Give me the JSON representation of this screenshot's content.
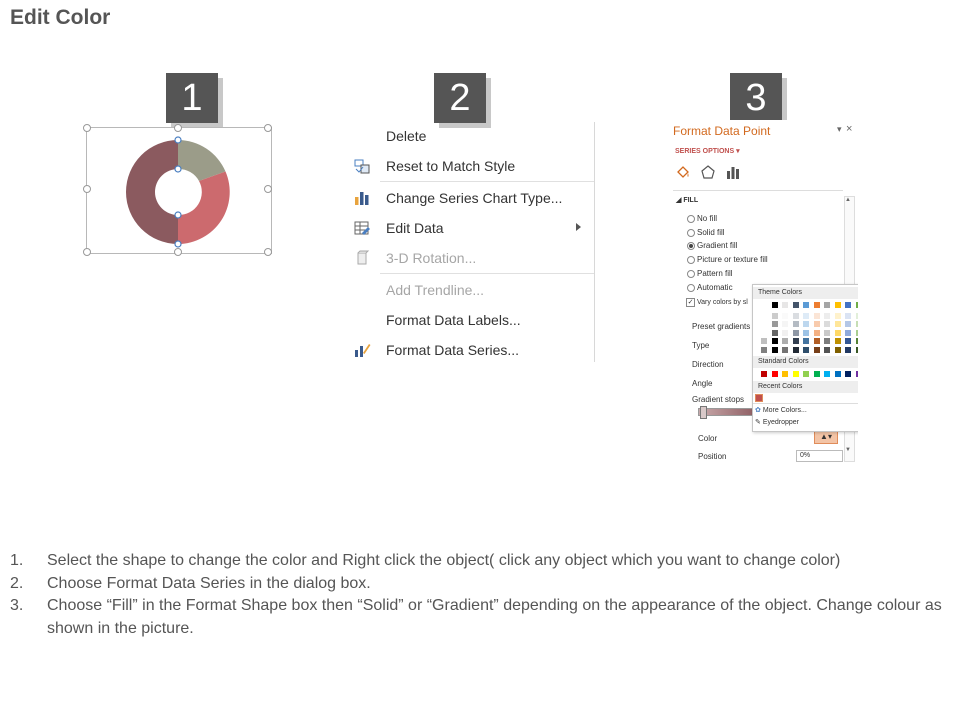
{
  "title": "Edit Color",
  "steps": [
    "1",
    "2",
    "3"
  ],
  "context_menu": {
    "items": [
      {
        "label": "Delete",
        "icon": "none-icon",
        "disabled": false
      },
      {
        "label": "Reset to Match Style",
        "icon": "reset-style-icon",
        "disabled": false
      },
      {
        "label": "Change Series Chart Type...",
        "icon": "bar-chart-icon",
        "disabled": false
      },
      {
        "label": "Edit Data",
        "icon": "edit-data-icon",
        "disabled": false,
        "submenu": true
      },
      {
        "label": "3-D Rotation...",
        "icon": "cube-icon",
        "disabled": true
      },
      {
        "label": "Add Trendline...",
        "icon": "none-icon",
        "disabled": true
      },
      {
        "label": "Format Data Labels...",
        "icon": "none-icon",
        "disabled": false
      },
      {
        "label": "Format Data Series...",
        "icon": "format-series-icon",
        "disabled": false
      }
    ]
  },
  "format_pane": {
    "title": "Format Data Point",
    "series_options": "SERIES OPTIONS",
    "fill_header": "FILL",
    "fill_options": [
      {
        "label": "No fill",
        "selected": false
      },
      {
        "label": "Solid fill",
        "selected": false
      },
      {
        "label": "Gradient fill",
        "selected": true
      },
      {
        "label": "Picture or texture fill",
        "selected": false
      },
      {
        "label": "Pattern fill",
        "selected": false
      },
      {
        "label": "Automatic",
        "selected": false
      }
    ],
    "vary_colors": "Vary colors by sl",
    "rows": [
      "Preset gradients",
      "Type",
      "Direction",
      "Angle",
      "Gradient stops",
      "Color",
      "Position"
    ],
    "position_value": "0%",
    "color_popup": {
      "theme_colors": "Theme Colors",
      "standard_colors": "Standard Colors",
      "recent_colors": "Recent Colors",
      "more_colors": "More Colors...",
      "eyedropper": "Eyedropper",
      "theme_top": [
        "#ffffff",
        "#000000",
        "#e7e6e6",
        "#44546a",
        "#5b9bd5",
        "#ed7d31",
        "#a5a5a5",
        "#ffc000",
        "#4472c4",
        "#70ad47"
      ],
      "standard": [
        "#c00000",
        "#ff0000",
        "#ffc000",
        "#ffff00",
        "#92d050",
        "#00b050",
        "#00b0f0",
        "#0070c0",
        "#002060",
        "#7030a0"
      ],
      "recent": [
        "#c0504d"
      ]
    }
  },
  "donut_colors": {
    "segment_a": "#9b9c89",
    "segment_b": "#cc6a6e",
    "segment_c": "#8b5a5f"
  },
  "instructions": [
    {
      "num": "1.",
      "text": "Select the shape to change the color and Right click the object( click any object which you want to change color)"
    },
    {
      "num": "2.",
      "text": "Choose Format Data Series in the dialog box."
    },
    {
      "num": "3.",
      "text": "Choose “Fill” in the Format Shape box then “Solid” or “Gradient” depending on the appearance of the object. Change colour as shown in the picture."
    }
  ]
}
